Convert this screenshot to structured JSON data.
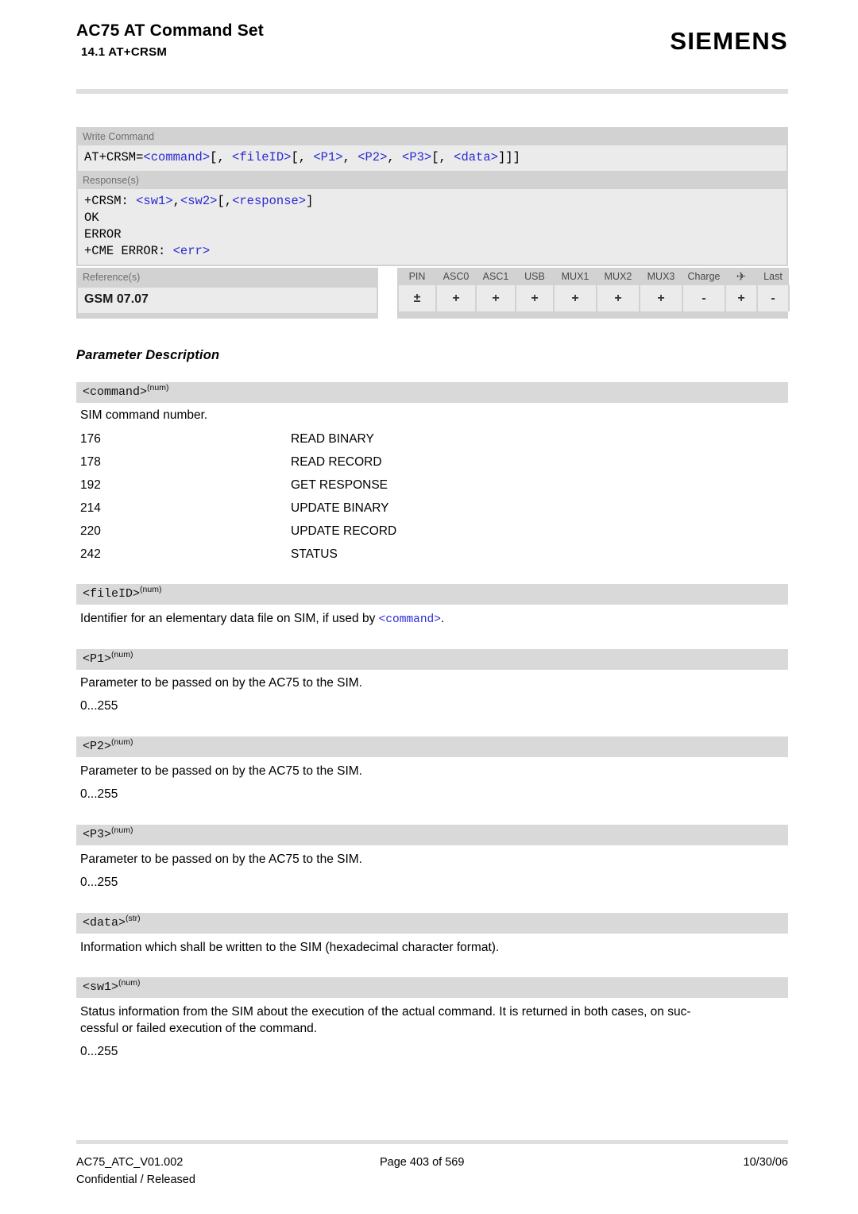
{
  "header": {
    "doc_title": "AC75 AT Command Set",
    "section": "14.1 AT+CRSM",
    "brand": "SIEMENS"
  },
  "syntax": {
    "write_label": "Write Command",
    "write_command": "AT+CRSM=<command>[, <fileID>[, <P1>, <P2>, <P3>[, <data>]]]",
    "response_label": "Response(s)",
    "response_lines": [
      "+CRSM: <sw1>,<sw2>[,<response>]",
      "OK",
      "ERROR",
      "+CME ERROR: <err>"
    ]
  },
  "reference": {
    "label": "Reference(s)",
    "value": "GSM 07.07"
  },
  "support": {
    "headers": [
      "PIN",
      "ASC0",
      "ASC1",
      "USB",
      "MUX1",
      "MUX2",
      "MUX3",
      "Charge",
      "airplane-icon",
      "Last"
    ],
    "values": [
      "±",
      "+",
      "+",
      "+",
      "+",
      "+",
      "+",
      "-",
      "+",
      "-"
    ]
  },
  "parameter_description": {
    "heading": "Parameter Description",
    "params": [
      {
        "name": "<command>",
        "type": "(num)",
        "description": "SIM command number.",
        "values": [
          {
            "code": "176",
            "meaning": "READ BINARY"
          },
          {
            "code": "178",
            "meaning": "READ RECORD"
          },
          {
            "code": "192",
            "meaning": "GET RESPONSE"
          },
          {
            "code": "214",
            "meaning": "UPDATE BINARY"
          },
          {
            "code": "220",
            "meaning": "UPDATE RECORD"
          },
          {
            "code": "242",
            "meaning": "STATUS"
          }
        ]
      },
      {
        "name": "<fileID>",
        "type": "(num)",
        "description_pre": "Identifier for an elementary data file on SIM, if used by ",
        "description_code": "<command>",
        "description_post": "."
      },
      {
        "name": "<P1>",
        "type": "(num)",
        "description": "Parameter to be passed on by the AC75 to the SIM.",
        "range": "0...255"
      },
      {
        "name": "<P2>",
        "type": "(num)",
        "description": "Parameter to be passed on by the AC75 to the SIM.",
        "range": "0...255"
      },
      {
        "name": "<P3>",
        "type": "(num)",
        "description": "Parameter to be passed on by the AC75 to the SIM.",
        "range": "0...255"
      },
      {
        "name": "<data>",
        "type": "(str)",
        "description": "Information which shall be written to the SIM (hexadecimal character format)."
      },
      {
        "name": "<sw1>",
        "type": "(num)",
        "description_line1": "Status information from the SIM about the execution of the actual command. It is returned in both cases, on suc-",
        "description_line2": "cessful or failed execution of the command.",
        "range": "0...255"
      }
    ]
  },
  "footer": {
    "doc_id": "AC75_ATC_V01.002",
    "page": "Page 403 of 569",
    "date": "10/30/06",
    "classification": "Confidential / Released"
  }
}
